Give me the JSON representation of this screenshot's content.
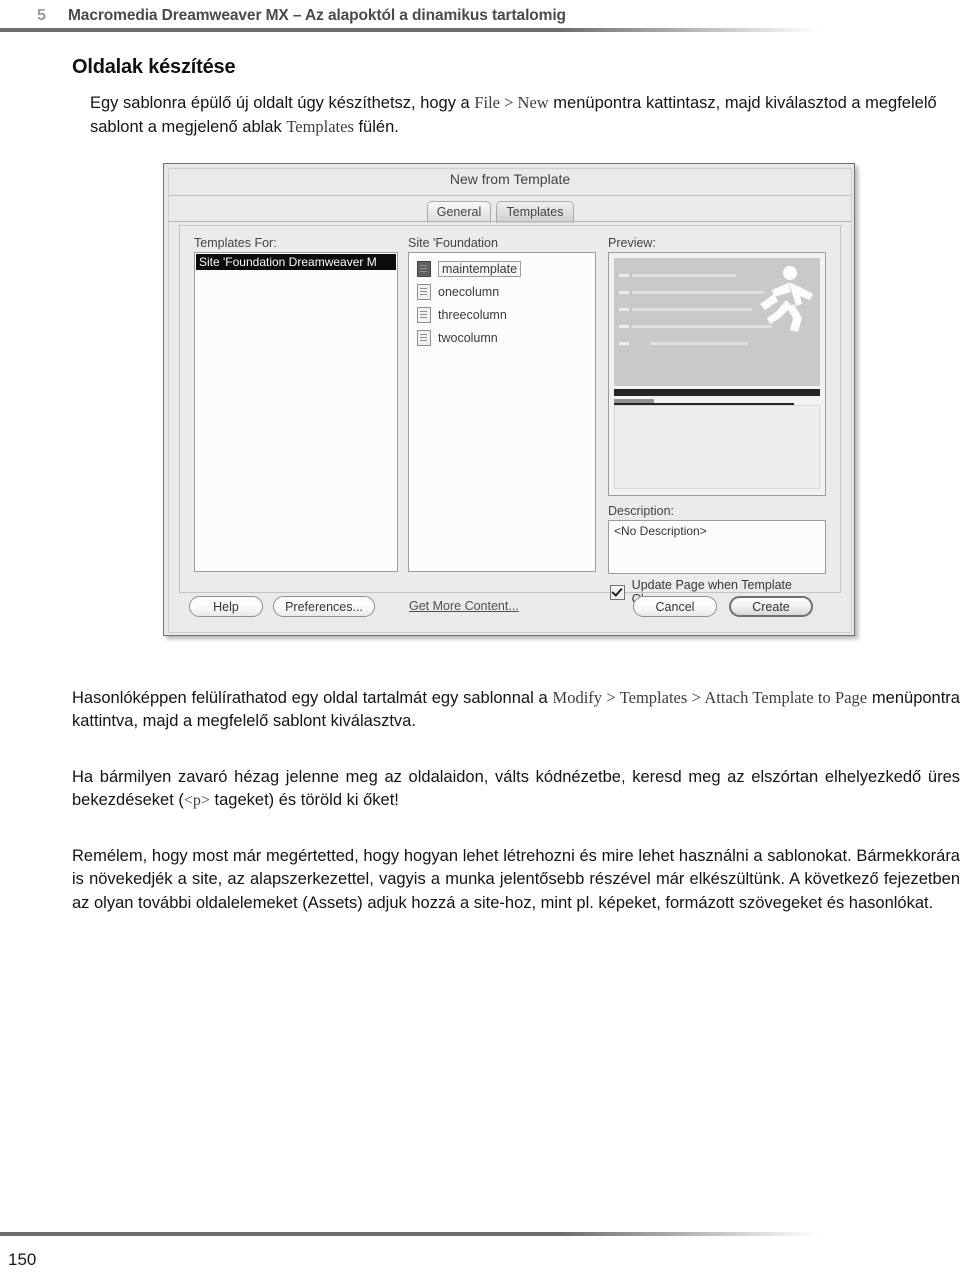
{
  "header": {
    "chapter_number": "5",
    "title": "Macromedia Dreamweaver MX – Az alapoktól a dinamikus tartalomig"
  },
  "section": {
    "title": "Oldalak készítése",
    "intro_part1": "Egy sablonra épülő új oldalt úgy készíthetsz, hogy a ",
    "intro_menu": "File > New",
    "intro_part2": " menüpontra kattintasz, majd kiválasztod a megfelelő sablont a megjelenő ablak ",
    "intro_tab": "Templates",
    "intro_part3": " fülén."
  },
  "dialog": {
    "title": "New from Template",
    "tabs": [
      {
        "label": "General",
        "active": false
      },
      {
        "label": "Templates",
        "active": true
      }
    ],
    "left_column": {
      "label": "Templates For:",
      "selected_item": "Site 'Foundation Dreamweaver M"
    },
    "middle_column": {
      "label": "Site 'Foundation",
      "items": [
        {
          "name": "maintemplate",
          "selected": true
        },
        {
          "name": "onecolumn",
          "selected": false
        },
        {
          "name": "threecolumn",
          "selected": false
        },
        {
          "name": "twocolumn",
          "selected": false
        }
      ]
    },
    "right_column": {
      "preview_label": "Preview:",
      "description_label": "Description:",
      "description_value": "<No Description>",
      "checkbox_label": "Update Page when Template Changes",
      "checkbox_checked": true
    },
    "buttons": {
      "help": "Help",
      "preferences": "Preferences...",
      "get_more_content": "Get More Content...",
      "cancel": "Cancel",
      "create": "Create"
    }
  },
  "paragraphs": {
    "p1_part1": "Hasonlóképpen felülírathatod egy oldal tartalmát egy sablonnal a ",
    "p1_menu": "Modify > Templates > Attach Template to Page",
    "p1_part2": " menüpontra kattintva, majd a megfelelő sablont kiválasztva.",
    "p2_part1": "Ha bármilyen zavaró hézag jelenne meg az oldalaidon, válts kódnézetbe, keresd meg az elszórtan elhelyezkedő üres bekezdéseket (",
    "p2_code": "<p>",
    "p2_part2": " tageket) és töröld ki őket!",
    "p3": "Remélem, hogy most már megértetted, hogy hogyan lehet létrehozni és mire lehet használni a sablonokat. Bármekkorára is növekedjék a site, az alapszerkezettel, vagyis a munka jelentősebb részével már elkészültünk. A következő fejezetben az olyan további oldalelemeket (Assets) adjuk hozzá a site-hoz, mint pl. képeket, formázott szövegeket és hasonlókat."
  },
  "folio": {
    "page_number": "150"
  },
  "colors": {
    "frame": "#6d6d6d",
    "header_number": "#9a9a9a",
    "header_title": "#4a4a4a",
    "body_text": "#141414",
    "ui_reference": "#3d3d3d"
  }
}
